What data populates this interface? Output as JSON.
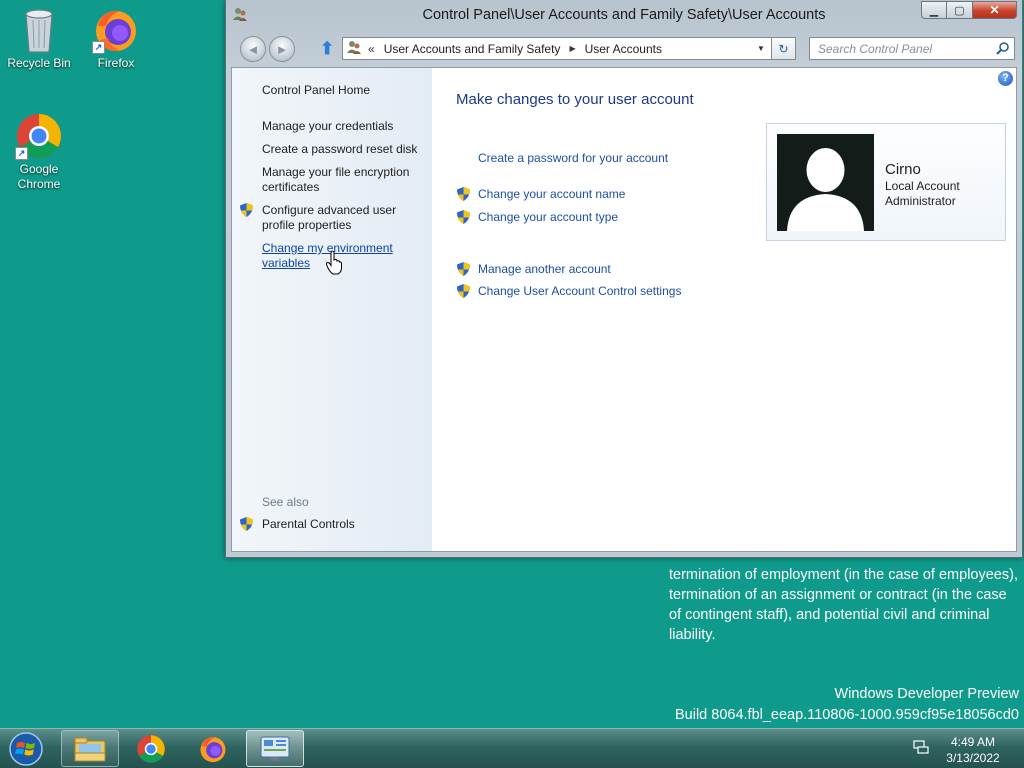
{
  "desktop": {
    "icons": [
      {
        "label": "Recycle Bin",
        "icon": "recycle-bin-icon"
      },
      {
        "label": "Firefox",
        "icon": "firefox-icon"
      },
      {
        "label": "Google Chrome",
        "icon": "chrome-icon"
      }
    ],
    "policy_text": "termination of employment (in the case of employees), termination of an assignment or contract (in the case of contingent staff), and potential civil and criminal liability.",
    "watermark_line1": "Windows Developer Preview",
    "watermark_line2": "Build 8064.fbl_eeap.110806-1000.959cf95e18056cd0"
  },
  "window": {
    "title": "Control Panel\\User Accounts and Family Safety\\User Accounts",
    "caption_buttons": {
      "minimize": "▁",
      "maximize": "▢",
      "close": "✕"
    },
    "nav": {
      "back": "◄",
      "forward": "►",
      "up": "⬆",
      "address_prefix": "«",
      "breadcrumbs": [
        "User Accounts and Family Safety",
        "User Accounts"
      ],
      "dropdown": "▼",
      "refresh": "↻",
      "search_placeholder": "Search Control Panel"
    },
    "help": "?",
    "left_pane": {
      "home": "Control Panel Home",
      "items": [
        {
          "label": "Manage your credentials"
        },
        {
          "label": "Create a password reset disk"
        },
        {
          "label": "Manage your file encryption certificates"
        },
        {
          "label": "Configure advanced user profile properties"
        },
        {
          "label": "Change my environment variables"
        }
      ],
      "see_also_heading": "See also",
      "see_also": [
        "Parental Controls"
      ]
    },
    "main": {
      "heading": "Make changes to your user account",
      "tasks": [
        {
          "label": "Create a password for your account",
          "shield": false
        },
        {
          "label": "Change your account name",
          "shield": true
        },
        {
          "label": "Change your account type",
          "shield": true
        },
        {
          "label": "Manage another account",
          "shield": true
        },
        {
          "label": "Change User Account Control settings",
          "shield": true
        }
      ]
    },
    "user": {
      "name": "Cirno",
      "account_kind": "Local Account",
      "role": "Administrator"
    }
  },
  "taskbar": {
    "items": [
      "start-orb-icon",
      "file-explorer-icon",
      "chrome-icon",
      "firefox-icon",
      "control-panel-icon"
    ],
    "clock_time": "4:49 AM",
    "clock_date": "3/13/2022"
  },
  "colors": {
    "desktop": "#0f9b8b",
    "link": "#1b4fa8",
    "heading": "#1a3a8a",
    "close_button": "#c8432c"
  }
}
